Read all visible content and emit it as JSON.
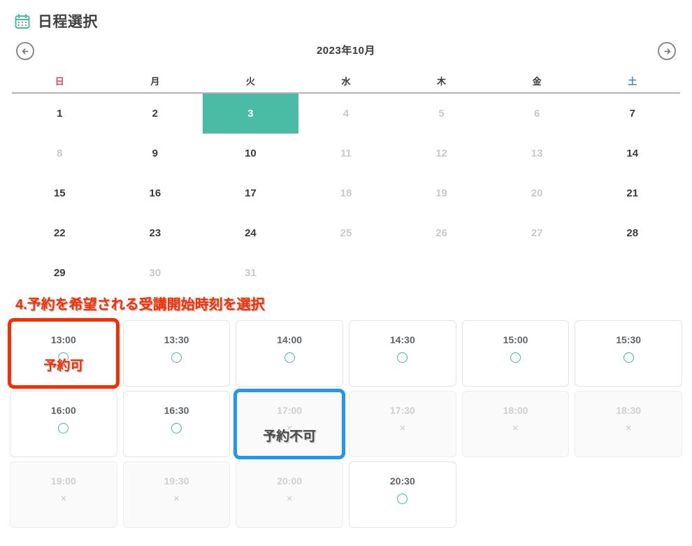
{
  "header": {
    "icon": "calendar-icon",
    "title": "日程選択"
  },
  "calendar": {
    "prev_icon": "arrow-left-circle-icon",
    "next_icon": "arrow-right-circle-icon",
    "month_label": "2023年10月",
    "weekdays": [
      {
        "label": "日",
        "kind": "sun"
      },
      {
        "label": "月",
        "kind": "day"
      },
      {
        "label": "火",
        "kind": "day"
      },
      {
        "label": "水",
        "kind": "day"
      },
      {
        "label": "木",
        "kind": "day"
      },
      {
        "label": "金",
        "kind": "day"
      },
      {
        "label": "土",
        "kind": "sat"
      }
    ],
    "selected_date": "3",
    "selected_color": "#4ABCA5",
    "dates": [
      {
        "label": "1",
        "state": "enabled"
      },
      {
        "label": "2",
        "state": "enabled"
      },
      {
        "label": "3",
        "state": "selected"
      },
      {
        "label": "4",
        "state": "muted"
      },
      {
        "label": "5",
        "state": "muted"
      },
      {
        "label": "6",
        "state": "muted"
      },
      {
        "label": "7",
        "state": "enabled"
      },
      {
        "label": "8",
        "state": "muted"
      },
      {
        "label": "9",
        "state": "enabled"
      },
      {
        "label": "10",
        "state": "enabled"
      },
      {
        "label": "11",
        "state": "muted"
      },
      {
        "label": "12",
        "state": "muted"
      },
      {
        "label": "13",
        "state": "muted"
      },
      {
        "label": "14",
        "state": "enabled"
      },
      {
        "label": "15",
        "state": "enabled"
      },
      {
        "label": "16",
        "state": "enabled"
      },
      {
        "label": "17",
        "state": "enabled"
      },
      {
        "label": "18",
        "state": "muted"
      },
      {
        "label": "19",
        "state": "muted"
      },
      {
        "label": "20",
        "state": "muted"
      },
      {
        "label": "21",
        "state": "enabled"
      },
      {
        "label": "22",
        "state": "enabled"
      },
      {
        "label": "23",
        "state": "enabled"
      },
      {
        "label": "24",
        "state": "enabled"
      },
      {
        "label": "25",
        "state": "muted"
      },
      {
        "label": "26",
        "state": "muted"
      },
      {
        "label": "27",
        "state": "muted"
      },
      {
        "label": "28",
        "state": "enabled"
      },
      {
        "label": "29",
        "state": "enabled"
      },
      {
        "label": "30",
        "state": "muted"
      },
      {
        "label": "31",
        "state": "muted"
      },
      {
        "label": "",
        "state": "empty"
      },
      {
        "label": "",
        "state": "empty"
      },
      {
        "label": "",
        "state": "empty"
      },
      {
        "label": "",
        "state": "empty"
      }
    ]
  },
  "annotations": {
    "heading": "4.予約を希望される受講開始時刻を選択",
    "heading_color": "#FB2D00",
    "available_tag": "予約可",
    "available_tag_color": "#FB2D00",
    "unavailable_tag": "予約不可",
    "unavailable_tag_color": "#4a4a4a",
    "red_box_color": "#FB2D00",
    "blue_box_color": "#2196F3"
  },
  "slots": {
    "available_mark": "○",
    "unavailable_mark": "×",
    "available_mark_color": "#3EB8A0",
    "items": [
      {
        "time": "13:00",
        "available": true,
        "mark": "circle",
        "highlight": "red",
        "tag": "予約可"
      },
      {
        "time": "13:30",
        "available": true,
        "mark": "circle",
        "highlight": "",
        "tag": ""
      },
      {
        "time": "14:00",
        "available": true,
        "mark": "circle",
        "highlight": "",
        "tag": ""
      },
      {
        "time": "14:30",
        "available": true,
        "mark": "circle",
        "highlight": "",
        "tag": ""
      },
      {
        "time": "15:00",
        "available": true,
        "mark": "circle",
        "highlight": "",
        "tag": ""
      },
      {
        "time": "15:30",
        "available": true,
        "mark": "circle",
        "highlight": "",
        "tag": ""
      },
      {
        "time": "16:00",
        "available": true,
        "mark": "circle",
        "highlight": "",
        "tag": ""
      },
      {
        "time": "16:30",
        "available": true,
        "mark": "circle",
        "highlight": "",
        "tag": ""
      },
      {
        "time": "17:00",
        "available": false,
        "mark": "cross",
        "highlight": "blue",
        "tag": "予約不可"
      },
      {
        "time": "17:30",
        "available": false,
        "mark": "cross",
        "highlight": "",
        "tag": ""
      },
      {
        "time": "18:00",
        "available": false,
        "mark": "cross",
        "highlight": "",
        "tag": ""
      },
      {
        "time": "18:30",
        "available": false,
        "mark": "cross",
        "highlight": "",
        "tag": ""
      },
      {
        "time": "19:00",
        "available": false,
        "mark": "cross",
        "highlight": "",
        "tag": ""
      },
      {
        "time": "19:30",
        "available": false,
        "mark": "cross",
        "highlight": "",
        "tag": ""
      },
      {
        "time": "20:00",
        "available": false,
        "mark": "cross",
        "highlight": "",
        "tag": ""
      },
      {
        "time": "20:30",
        "available": true,
        "mark": "circle",
        "highlight": "",
        "tag": ""
      }
    ]
  }
}
